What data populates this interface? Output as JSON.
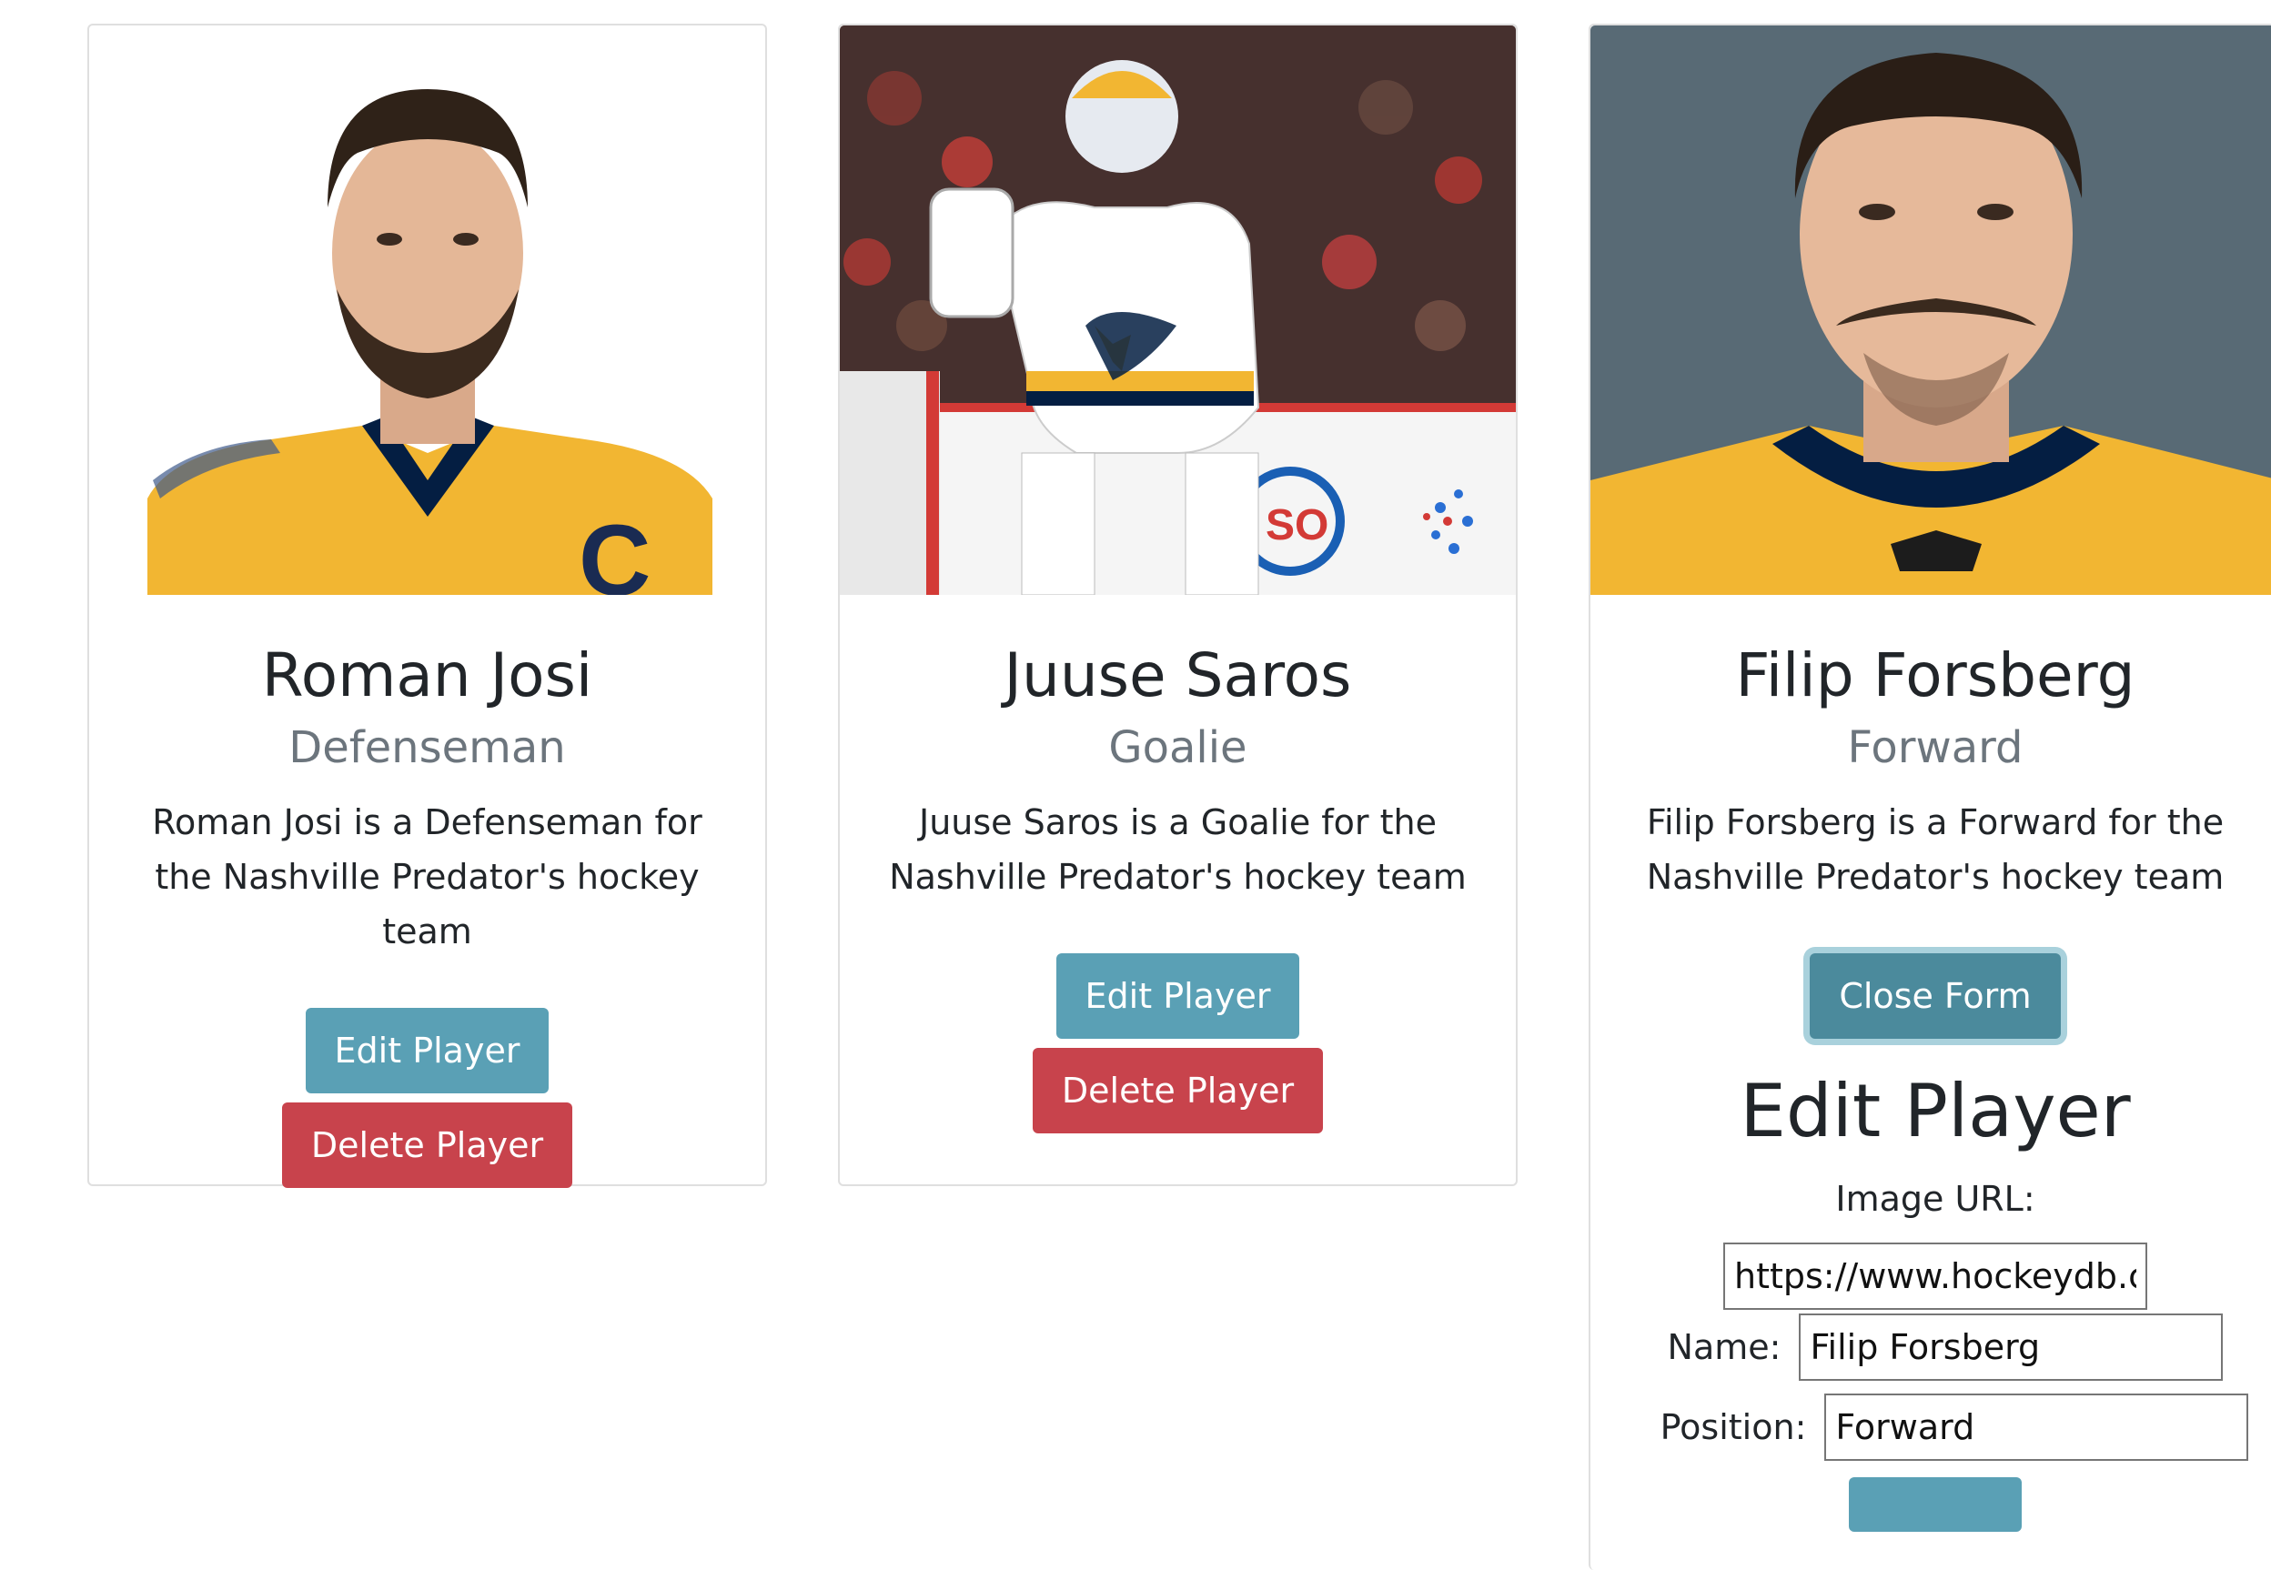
{
  "players": [
    {
      "name": "Roman Josi",
      "position": "Defenseman",
      "description": "Roman Josi is a Defenseman for the Nashville Predator's hockey team",
      "edit_label": "Edit Player",
      "delete_label": "Delete Player",
      "jersey_letter": "C"
    },
    {
      "name": "Juuse Saros",
      "position": "Goalie",
      "description": "Juuse Saros is a Goalie for the Nashville Predator's hockey team",
      "edit_label": "Edit Player",
      "delete_label": "Delete Player",
      "sign_text": "SO"
    },
    {
      "name": "Filip Forsberg",
      "position": "Forward",
      "description": "Filip Forsberg is a Forward for the Nashville Predator's hockey team",
      "close_label": "Close Form"
    }
  ],
  "edit_form": {
    "title": "Edit Player",
    "image_url_label": "Image URL:",
    "image_url_value": "https://www.hockeydb.co",
    "name_label": "Name:",
    "name_value": "Filip Forsberg",
    "position_label": "Position:",
    "position_value": "Forward"
  },
  "colors": {
    "info": "#5aa0b5",
    "danger": "#c8434c",
    "jersey_gold": "#f2b632",
    "jersey_navy": "#041e42"
  }
}
